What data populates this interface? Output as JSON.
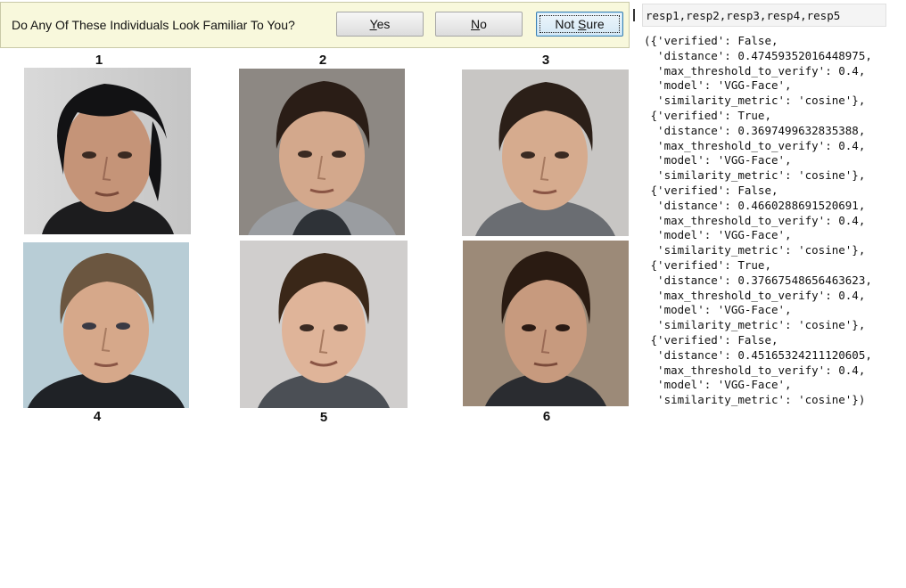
{
  "dialog": {
    "prompt": "Do Any Of These Individuals Look Familiar To You?",
    "buttons": {
      "yes": {
        "mnemonic": "Y",
        "rest": "es"
      },
      "no": {
        "mnemonic": "N",
        "rest": "o"
      },
      "not_sure": {
        "pre": "Not ",
        "mnemonic": "S",
        "rest": "ure"
      }
    },
    "faces": [
      {
        "number": "1",
        "icon": "face-photo-icon"
      },
      {
        "number": "2",
        "icon": "face-photo-icon"
      },
      {
        "number": "3",
        "icon": "face-photo-icon"
      },
      {
        "number": "4",
        "icon": "face-photo-icon"
      },
      {
        "number": "5",
        "icon": "face-photo-icon"
      },
      {
        "number": "6",
        "icon": "face-photo-icon"
      }
    ]
  },
  "console": {
    "input": "resp1,resp2,resp3,resp4,resp5",
    "output_lines": [
      "({'verified': False,",
      "  'distance': 0.47459352016448975,",
      "  'max_threshold_to_verify': 0.4,",
      "  'model': 'VGG-Face',",
      "  'similarity_metric': 'cosine'},",
      " {'verified': True,",
      "  'distance': 0.3697499632835388,",
      "  'max_threshold_to_verify': 0.4,",
      "  'model': 'VGG-Face',",
      "  'similarity_metric': 'cosine'},",
      " {'verified': False,",
      "  'distance': 0.4660288691520691,",
      "  'max_threshold_to_verify': 0.4,",
      "  'model': 'VGG-Face',",
      "  'similarity_metric': 'cosine'},",
      " {'verified': True,",
      "  'distance': 0.37667548656463623,",
      "  'max_threshold_to_verify': 0.4,",
      "  'model': 'VGG-Face',",
      "  'similarity_metric': 'cosine'},",
      " {'verified': False,",
      "  'distance': 0.45165324211120605,",
      "  'max_threshold_to_verify': 0.4,",
      "  'model': 'VGG-Face',",
      "  'similarity_metric': 'cosine'})"
    ]
  },
  "colors": {
    "prompt_bg": "#f8f8dc",
    "focus_border": "#3c7fb1"
  }
}
